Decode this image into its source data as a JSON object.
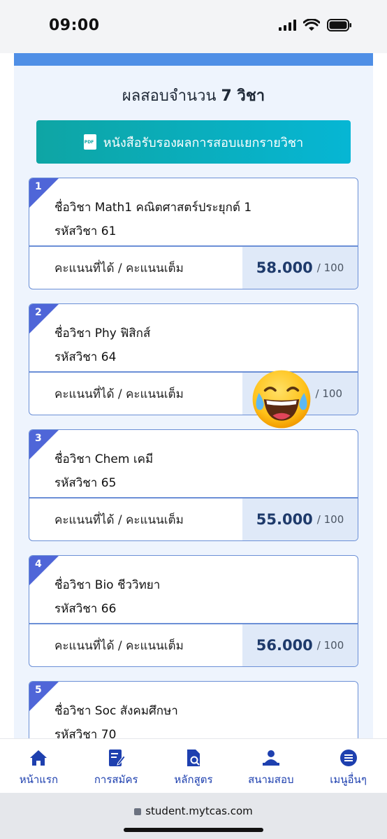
{
  "status": {
    "time": "09:00"
  },
  "page": {
    "heading_prefix": "ผลสอบจำนวน",
    "heading_count": "7 วิชา",
    "cert_button_label": "หนังสือรับรองผลการสอบแยกรายวิชา"
  },
  "score_label": "คะแนนที่ได้ / คะแนนเต็ม",
  "subjects": [
    {
      "num": "1",
      "name_line": "ชื่อวิชา Math1 คณิตศาสตร์ประยุกต์ 1",
      "code_line": "รหัสวิชา 61",
      "score": "58.000",
      "full": "/ 100"
    },
    {
      "num": "2",
      "name_line": "ชื่อวิชา Phy ฟิสิกส์",
      "code_line": "รหัสวิชา 64",
      "score": "",
      "full": "/ 100"
    },
    {
      "num": "3",
      "name_line": "ชื่อวิชา Chem เคมี",
      "code_line": "รหัสวิชา 65",
      "score": "55.000",
      "full": "/ 100"
    },
    {
      "num": "4",
      "name_line": "ชื่อวิชา Bio ชีววิทยา",
      "code_line": "รหัสวิชา 66",
      "score": "56.000",
      "full": "/ 100"
    },
    {
      "num": "5",
      "name_line": "ชื่อวิชา Soc สังคมศึกษา",
      "code_line": "รหัสวิชา 70",
      "score": "",
      "full": ""
    }
  ],
  "nav": [
    {
      "label": "หน้าแรก",
      "icon": "home-icon"
    },
    {
      "label": "การสมัคร",
      "icon": "application-icon"
    },
    {
      "label": "หลักสูตร",
      "icon": "course-search-icon"
    },
    {
      "label": "สนามสอบ",
      "icon": "exam-venue-icon"
    },
    {
      "label": "เมนูอื่นๆ",
      "icon": "more-menu-icon"
    }
  ],
  "browser": {
    "url": "student.mytcas.com"
  },
  "colors": {
    "accent": "#4f8fe6",
    "teal": "#0ea5a4",
    "nav": "#1e40af"
  }
}
